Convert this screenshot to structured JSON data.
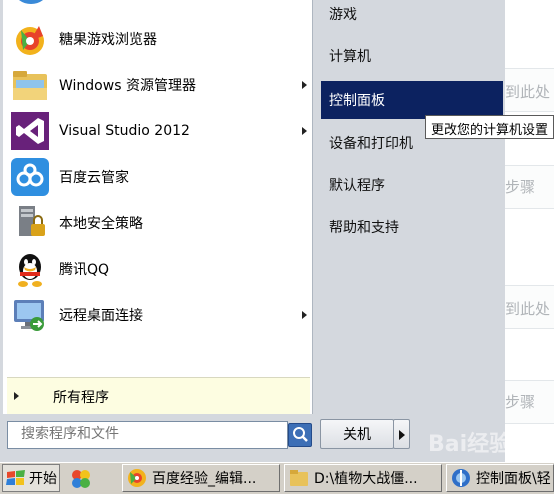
{
  "start_menu": {
    "programs": [
      {
        "label": "糖果游戏浏览器",
        "icon": "candy-browser-icon",
        "has_submenu": false
      },
      {
        "label": "Windows 资源管理器",
        "icon": "folder-explorer-icon",
        "has_submenu": true
      },
      {
        "label": "Visual Studio 2012",
        "icon": "visual-studio-icon",
        "has_submenu": true
      },
      {
        "label": "百度云管家",
        "icon": "baidu-cloud-icon",
        "has_submenu": false
      },
      {
        "label": "本地安全策略",
        "icon": "security-policy-icon",
        "has_submenu": false
      },
      {
        "label": "腾讯QQ",
        "icon": "qq-penguin-icon",
        "has_submenu": false
      },
      {
        "label": "远程桌面连接",
        "icon": "remote-desktop-icon",
        "has_submenu": true
      }
    ],
    "all_programs_label": "所有程序",
    "search_placeholder": "搜索程序和文件",
    "places": [
      {
        "label": "游戏",
        "active": false
      },
      {
        "label": "计算机",
        "active": false
      },
      {
        "label": "控制面板",
        "active": true
      },
      {
        "label": "设备和打印机",
        "active": false
      },
      {
        "label": "默认程序",
        "active": false
      },
      {
        "label": "帮助和支持",
        "active": false
      }
    ],
    "shutdown_label": "关机",
    "tooltip": "更改您的计算机设置"
  },
  "background_page": {
    "snippets": [
      "到此处",
      "步骤",
      "到此处",
      "步骤"
    ]
  },
  "taskbar": {
    "start_label": "开始",
    "buttons": [
      {
        "label": "百度经验_编辑...",
        "icon": "browser-icon"
      },
      {
        "label": "D:\\植物大战僵...",
        "icon": "folder-icon"
      },
      {
        "label": "控制面板\\轻",
        "icon": "control-panel-icon"
      }
    ]
  },
  "watermark": "Bai经验",
  "colors": {
    "highlight": "#0c2260",
    "all_programs_bg": "#fdfde1",
    "menu_frame": "#d4d8de"
  }
}
